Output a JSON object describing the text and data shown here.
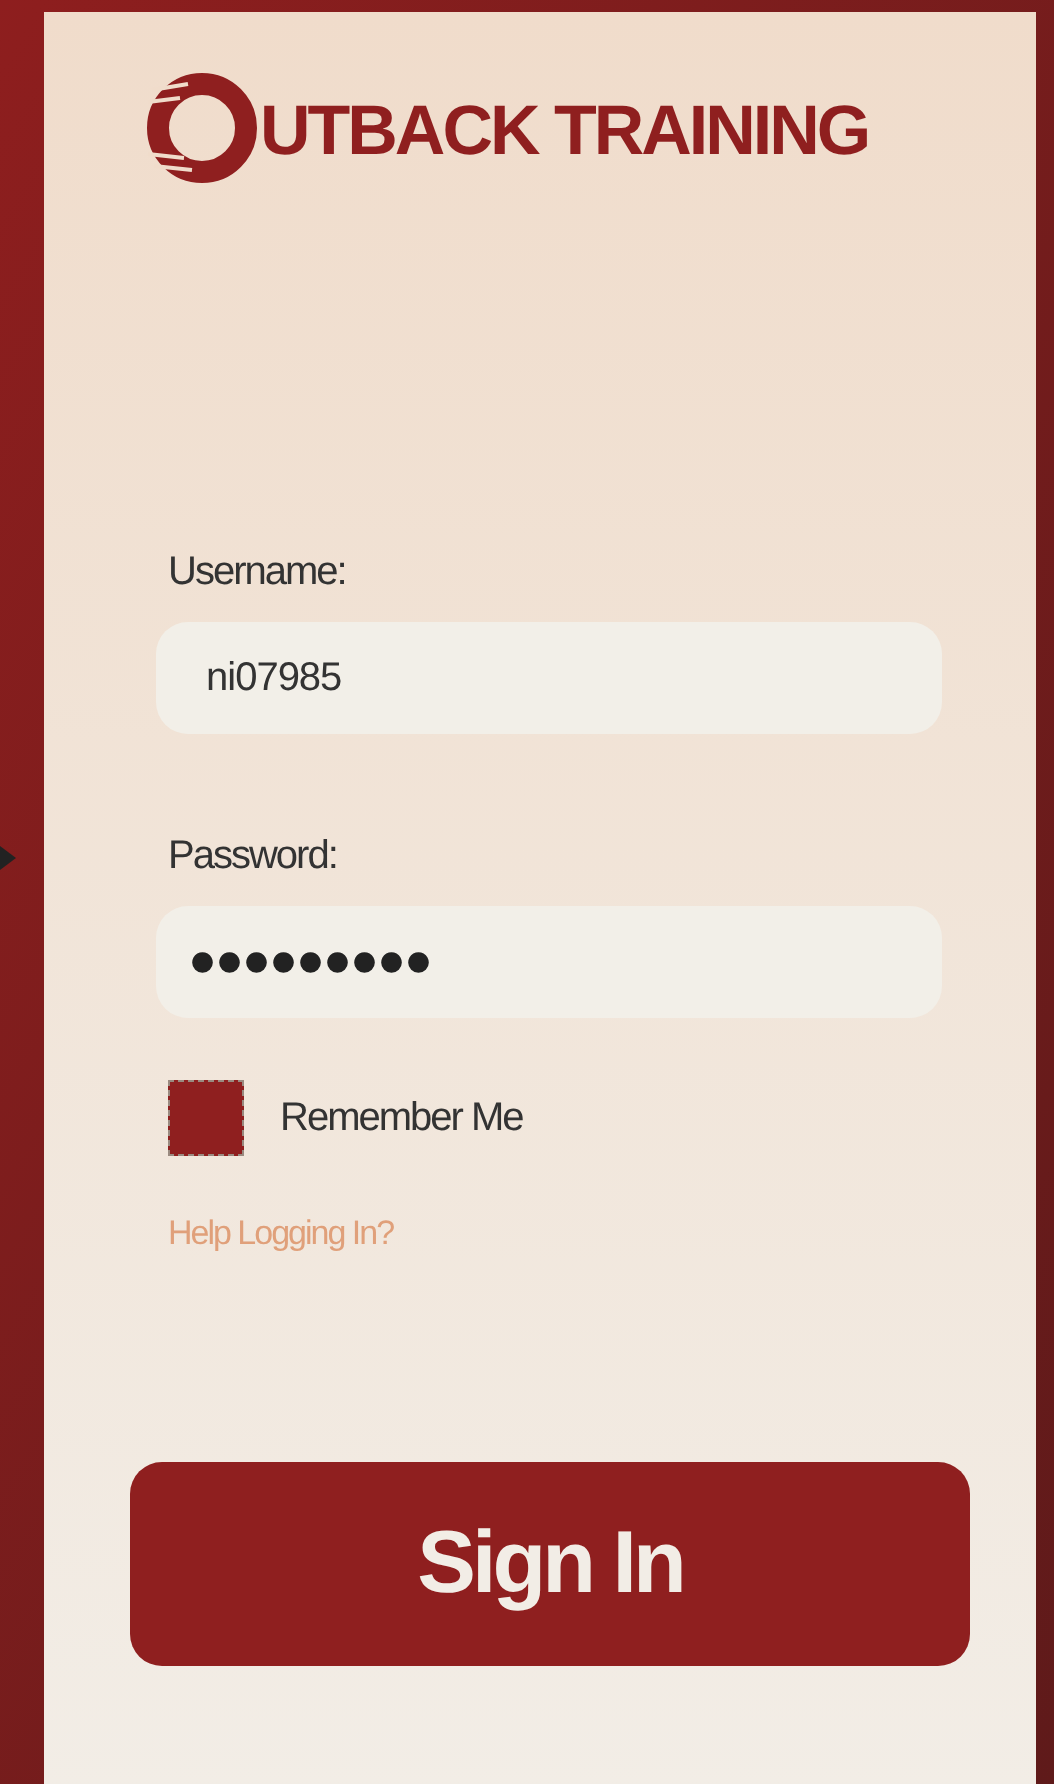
{
  "logo": {
    "text": "UTBACK TRAINING"
  },
  "username": {
    "label": "Username:",
    "value": "ni07985"
  },
  "password": {
    "label": "Password:",
    "value": "●●●●●●●●●"
  },
  "remember": {
    "label": "Remember Me",
    "checked": true
  },
  "help_link": "Help Logging In?",
  "sign_in": "Sign In"
}
